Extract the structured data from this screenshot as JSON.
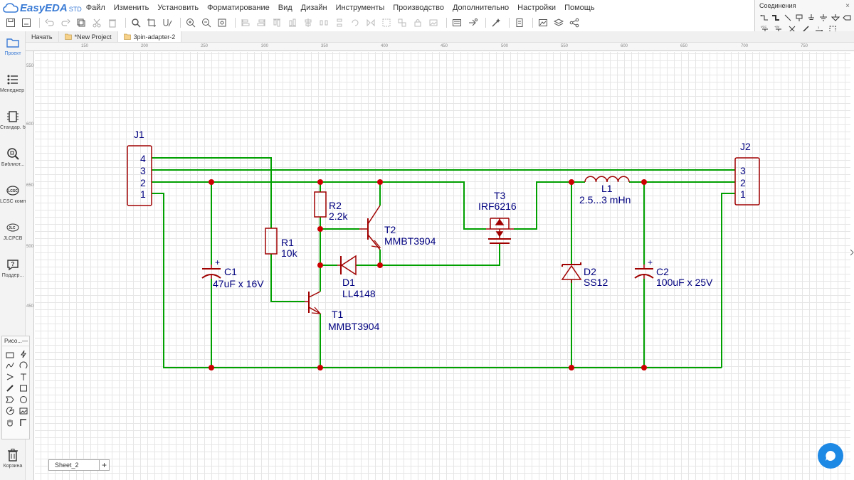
{
  "app": {
    "logo_text": "EasyEDA",
    "logo_suffix": "STD"
  },
  "menu": [
    "Файл",
    "Изменить",
    "Установить",
    "Форматирование",
    "Вид",
    "Дизайн",
    "Инструменты",
    "Производство",
    "Дополнительно",
    "Настройки",
    "Помощь"
  ],
  "connections_panel": {
    "title": "Соединения",
    "row2_label_a": "VCC",
    "row2_label_b": "+5V"
  },
  "sidebar": [
    {
      "label": "Проект",
      "icon": "folder-icon"
    },
    {
      "label": "Менеджер проектир",
      "icon": "list-icon"
    },
    {
      "label": "Стандар. библиот...",
      "icon": "chip-icon"
    },
    {
      "label": "Библиот...",
      "icon": "search-library-icon"
    },
    {
      "label": "LCSC компоне...",
      "icon": "lcsc-icon"
    },
    {
      "label": "JLCPCB",
      "icon": "jlcpcb-icon"
    },
    {
      "label": "Поддер...",
      "icon": "help-icon"
    }
  ],
  "sidebar_lcsc_logo": "LCSC",
  "sidebar_jlc_logo": "JLC",
  "trash_label": "Корзина",
  "draw_panel": {
    "title": "Рисо...",
    "collapse": "—"
  },
  "tabs": [
    {
      "label": "Начать",
      "icon": ""
    },
    {
      "label": "*New Project",
      "icon": "project-icon"
    },
    {
      "label": "3pin-adapter-2",
      "icon": "schematic-icon"
    }
  ],
  "ruler_top": [
    "150",
    "200",
    "250",
    "300",
    "350",
    "400",
    "450",
    "500",
    "550",
    "600",
    "650",
    "700",
    "750"
  ],
  "ruler_left": [
    "550",
    "600",
    "650",
    "500",
    "450"
  ],
  "sheet": {
    "name": "Sheet_2",
    "add": "+"
  },
  "schematic": {
    "wire_color": "#00a000",
    "part_color": "#a00000",
    "label_color": "#000080",
    "J1": {
      "ref": "J1",
      "pins": [
        "4",
        "3",
        "2",
        "1"
      ]
    },
    "J2": {
      "ref": "J2",
      "pins": [
        "3",
        "2",
        "1"
      ]
    },
    "R1": {
      "ref": "R1",
      "value": "10k"
    },
    "R2": {
      "ref": "R2",
      "value": "2.2k"
    },
    "C1": {
      "ref": "C1",
      "value": "47uF x 16V",
      "polarity": "+"
    },
    "C2": {
      "ref": "C2",
      "value": "100uF x 25V",
      "polarity": "+"
    },
    "T1": {
      "ref": "T1",
      "value": "MMBT3904"
    },
    "T2": {
      "ref": "T2",
      "value": "MMBT3904"
    },
    "T3": {
      "ref": "T3",
      "value": "IRF6216"
    },
    "D1": {
      "ref": "D1",
      "value": "LL4148"
    },
    "D2": {
      "ref": "D2",
      "value": "SS12"
    },
    "L1": {
      "ref": "L1",
      "value": "2.5...3 mHn"
    }
  }
}
